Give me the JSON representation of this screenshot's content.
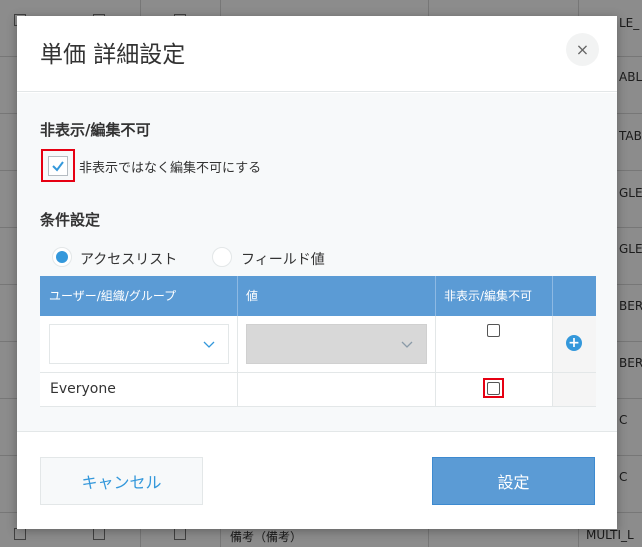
{
  "background": {
    "visible_texts": [
      "ABLE",
      "LE_",
      "TAB",
      "GLE_",
      "GLE_",
      "BER",
      "BER",
      "C",
      "C",
      "MULTI_L",
      "備考（備考）"
    ]
  },
  "dialog": {
    "title": "単価 詳細設定",
    "close_icon": "×",
    "section_hide": {
      "title": "非表示/編集不可",
      "checkbox_label": "非表示ではなく編集不可にする",
      "checked": true
    },
    "section_condition": {
      "title": "条件設定",
      "radio_options": [
        {
          "label": "アクセスリスト",
          "selected": true
        },
        {
          "label": "フィールド値",
          "selected": false
        }
      ],
      "table": {
        "headers": [
          "ユーザー/組織/グループ",
          "値",
          "非表示/編集不可"
        ],
        "new_row": {
          "user": "",
          "value": "",
          "checked": false
        },
        "rows": [
          {
            "user": "Everyone",
            "value": "",
            "checked": false
          }
        ]
      }
    },
    "footer": {
      "cancel_label": "キャンセル",
      "ok_label": "設定"
    }
  },
  "colors": {
    "accent": "#3498db",
    "header_blue": "#5b9bd5",
    "highlight_red": "#e60012"
  }
}
